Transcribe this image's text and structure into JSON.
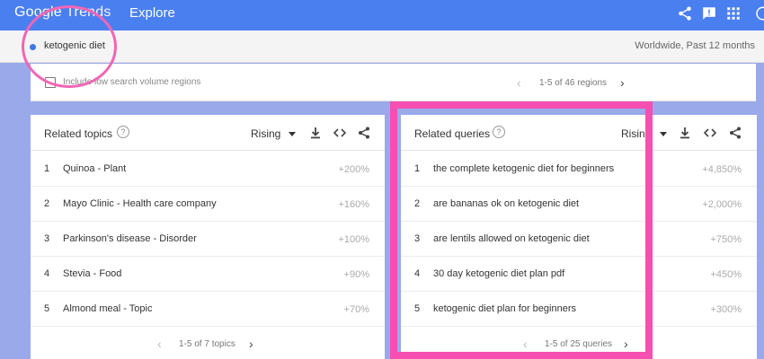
{
  "header": {
    "logo_google": "Google",
    "logo_trends": "Trends",
    "nav_explore": "Explore",
    "icons": [
      "share-icon",
      "feedback-icon",
      "apps-grid-icon",
      "account-icon"
    ],
    "brand_color": "#4a7ff0"
  },
  "search": {
    "term": "ketogenic diet",
    "term_color": "#3b78e7",
    "scope": "Worldwide, Past 12 months"
  },
  "regions": {
    "include_low_volume": "Include low search volume regions",
    "pager": "1-5 of 46 regions"
  },
  "related_topics": {
    "title": "Related topics",
    "filter": "Rising",
    "items": [
      {
        "rank": "1",
        "name": "Quinoa - Plant",
        "value": "+200%"
      },
      {
        "rank": "2",
        "name": "Mayo Clinic - Health care company",
        "value": "+160%"
      },
      {
        "rank": "3",
        "name": "Parkinson's disease - Disorder",
        "value": "+100%"
      },
      {
        "rank": "4",
        "name": "Stevia - Food",
        "value": "+90%"
      },
      {
        "rank": "5",
        "name": "Almond meal - Topic",
        "value": "+70%"
      }
    ],
    "pager": "1-5 of 7 topics"
  },
  "related_queries": {
    "title": "Related queries",
    "filter": "Rising",
    "items": [
      {
        "rank": "1",
        "name": "the complete ketogenic diet for beginners",
        "value": "+4,850%"
      },
      {
        "rank": "2",
        "name": "are bananas ok on ketogenic diet",
        "value": "+2,000%"
      },
      {
        "rank": "3",
        "name": "are lentils allowed on ketogenic diet",
        "value": "+750%"
      },
      {
        "rank": "4",
        "name": "30 day ketogenic diet plan pdf",
        "value": "+450%"
      },
      {
        "rank": "5",
        "name": "ketogenic diet plan for beginners",
        "value": "+300%"
      }
    ],
    "pager": "1-5 of 25 queries"
  },
  "annotations": {
    "highlight_color": "#f64fb1"
  }
}
